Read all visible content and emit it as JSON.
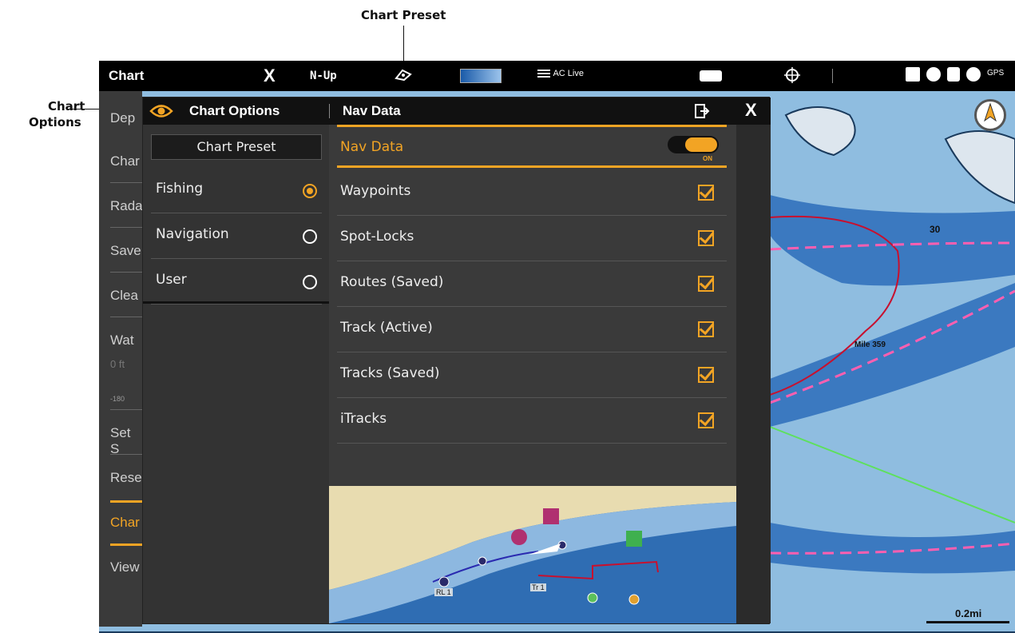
{
  "callouts": {
    "chart_preset": "Chart Preset",
    "chart_options_line1": "Chart",
    "chart_options_line2": "Options"
  },
  "topbar": {
    "title": "Chart",
    "close": "X",
    "orientation": "N-Up",
    "aclive": "AC Live",
    "gps": "GPS"
  },
  "left_menu": {
    "items": [
      "Dep",
      "Char",
      "Rada",
      "Save",
      "Clea",
      "Wat",
      "0 ft",
      "-180",
      "Set S",
      "Rese",
      "Char",
      "View"
    ]
  },
  "panel": {
    "header": {
      "title": "Chart Options",
      "section": "Nav Data",
      "close": "X"
    },
    "preset_button": "Chart Preset",
    "presets": [
      {
        "label": "Fishing",
        "selected": true
      },
      {
        "label": "Navigation",
        "selected": false
      },
      {
        "label": "User",
        "selected": false
      }
    ],
    "nav_data": {
      "label": "Nav Data",
      "toggle": "ON"
    },
    "items": [
      {
        "label": "Waypoints",
        "checked": true
      },
      {
        "label": "Spot-Locks",
        "checked": true
      },
      {
        "label": "Routes (Saved)",
        "checked": true
      },
      {
        "label": "Track (Active)",
        "checked": true
      },
      {
        "label": "Tracks (Saved)",
        "checked": true
      },
      {
        "label": "iTracks",
        "checked": true
      }
    ],
    "preview_labels": {
      "route": "RL 1",
      "track": "Tr 1"
    }
  },
  "map": {
    "depth_label": "30",
    "mile_label": "Mile 359",
    "scale": "0.2mi"
  },
  "colors": {
    "accent": "#f2a424",
    "water": "#7fb0d6",
    "panel": "#333333"
  }
}
